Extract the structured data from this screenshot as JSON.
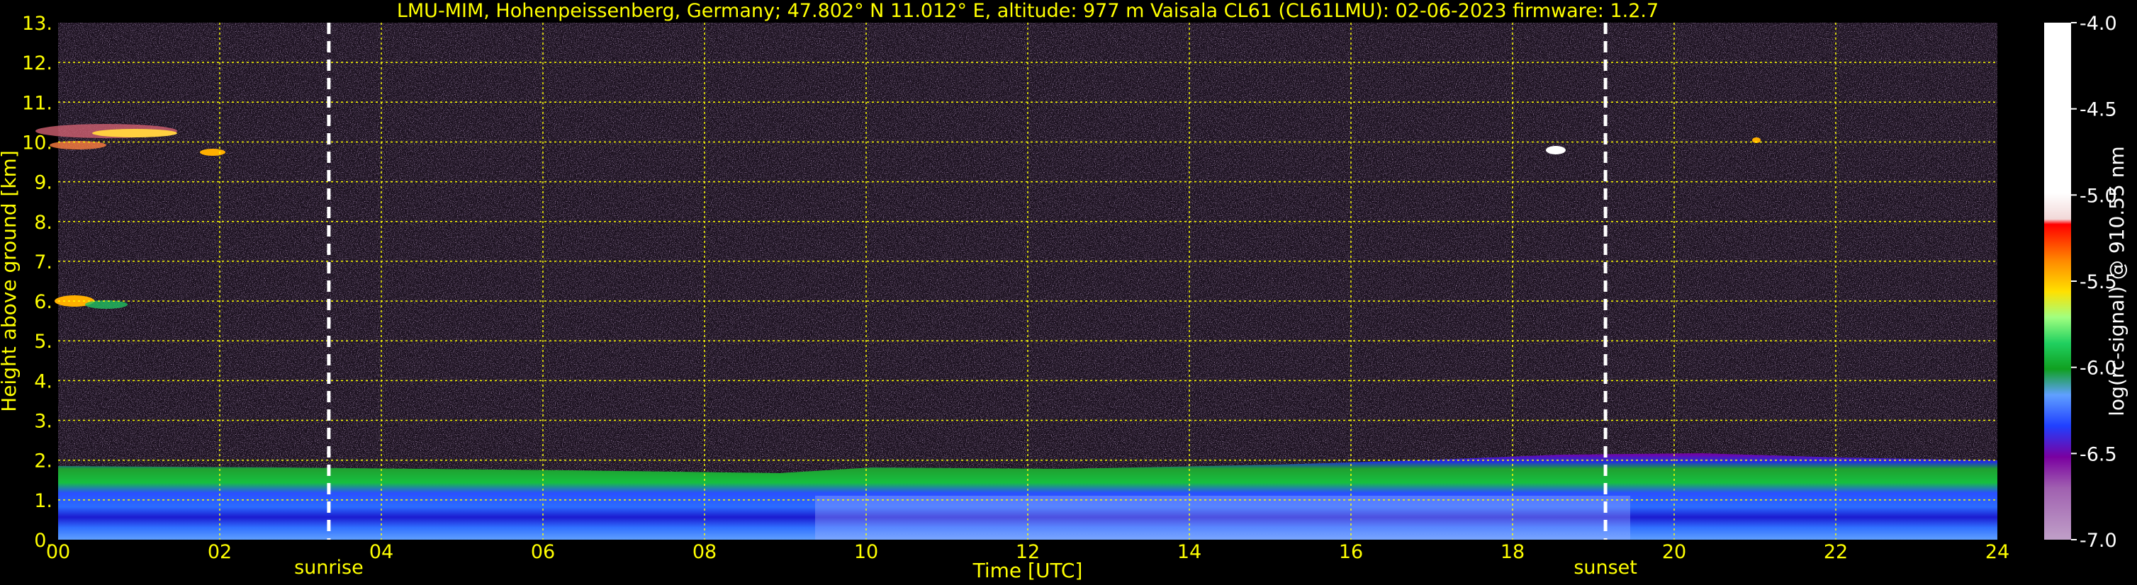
{
  "chart_data": {
    "type": "heatmap",
    "title": "LMU-MIM, Hohenpeissenberg, Germany; 47.802° N 11.012° E, altitude: 977 m    Vaisala CL61 (CL61LMU): 02-06-2023    firmware: 1.2.7",
    "xlabel": "Time [UTC]",
    "ylabel": "Height above ground [km]",
    "xlim": [
      0,
      24
    ],
    "ylim": [
      0,
      13
    ],
    "x_ticks": [
      "00",
      "02",
      "04",
      "06",
      "08",
      "10",
      "12",
      "14",
      "16",
      "18",
      "20",
      "22",
      "24"
    ],
    "y_ticks": [
      "0.",
      "1.",
      "2.",
      "3.",
      "4.",
      "5.",
      "6.",
      "7.",
      "8.",
      "9.",
      "10.",
      "11.",
      "12.",
      "13."
    ],
    "grid": true,
    "colorbar": {
      "label": "log(rc-signal) @ 910.55 nm",
      "range": [
        -7.0,
        -4.0
      ],
      "ticks": [
        "-4.0",
        "-4.5",
        "-5.0",
        "-5.5",
        "-6.0",
        "-6.5",
        "-7.0"
      ]
    },
    "annotations": [
      {
        "text": "sunrise",
        "x": 3.35
      },
      {
        "text": "sunset",
        "x": 19.15
      }
    ],
    "features": {
      "boundary_layer_top_km": 1.8,
      "cirrus_layer": {
        "x_start": 0,
        "x_end": 2.1,
        "y_km": 10.2
      },
      "mid_cloud": {
        "x_start": 0,
        "x_end": 0.9,
        "y_km": 5.9
      }
    }
  }
}
